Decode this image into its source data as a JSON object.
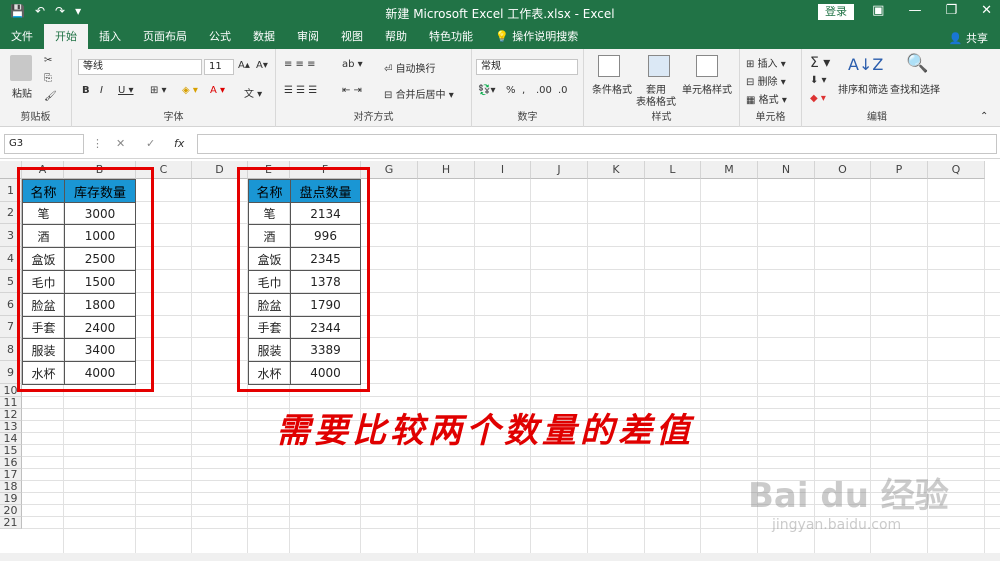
{
  "titlebar": {
    "title": "新建 Microsoft Excel 工作表.xlsx  -  Excel",
    "login": "登录",
    "qat": [
      "💾",
      "↶",
      "↷",
      "▾"
    ],
    "winbtns": [
      "▣",
      "—",
      "❐",
      "✕"
    ]
  },
  "tabs": [
    "文件",
    "开始",
    "插入",
    "页面布局",
    "公式",
    "数据",
    "审阅",
    "视图",
    "帮助",
    "特色功能",
    "💡 操作说明搜索"
  ],
  "share": "共享",
  "ribbon": {
    "clipboard": {
      "paste": "粘贴",
      "label": "剪贴板"
    },
    "font": {
      "name": "等线",
      "size": "11",
      "label": "字体"
    },
    "align": {
      "wrap": "自动换行",
      "merge": "合并后居中",
      "label": "对齐方式"
    },
    "number": {
      "format": "常规",
      "label": "数字"
    },
    "styles": {
      "cond": "条件格式",
      "table1": "套用",
      "table2": "表格格式",
      "cell": "单元格样式",
      "label": "样式"
    },
    "cells": {
      "insert": "插入",
      "delete": "删除",
      "format": "格式",
      "label": "单元格"
    },
    "edit": {
      "sort": "排序和筛选",
      "find": "查找和选择",
      "label": "编辑"
    }
  },
  "formula": {
    "namebox": "G3",
    "fx": "fx"
  },
  "columns": [
    "A",
    "B",
    "C",
    "D",
    "E",
    "F",
    "G",
    "H",
    "I",
    "J",
    "K",
    "L",
    "M",
    "N",
    "O",
    "P",
    "Q"
  ],
  "rows": [
    "1",
    "2",
    "3",
    "4",
    "5",
    "6",
    "7",
    "8",
    "9",
    "10",
    "11",
    "12",
    "13",
    "14",
    "15",
    "16",
    "17",
    "18",
    "19",
    "20",
    "21"
  ],
  "table1": {
    "headers": [
      "名称",
      "库存数量"
    ],
    "rows": [
      [
        "笔",
        "3000"
      ],
      [
        "酒",
        "1000"
      ],
      [
        "盒饭",
        "2500"
      ],
      [
        "毛巾",
        "1500"
      ],
      [
        "脸盆",
        "1800"
      ],
      [
        "手套",
        "2400"
      ],
      [
        "服装",
        "3400"
      ],
      [
        "水杯",
        "4000"
      ]
    ]
  },
  "table2": {
    "headers": [
      "名称",
      "盘点数量"
    ],
    "rows": [
      [
        "笔",
        "2134"
      ],
      [
        "酒",
        "996"
      ],
      [
        "盒饭",
        "2345"
      ],
      [
        "毛巾",
        "1378"
      ],
      [
        "脸盆",
        "1790"
      ],
      [
        "手套",
        "2344"
      ],
      [
        "服装",
        "3389"
      ],
      [
        "水杯",
        "4000"
      ]
    ]
  },
  "annotation": "需要比较两个数量的差值",
  "watermark": {
    "big": "Bai du 经验",
    "small": "jingyan.baidu.com"
  }
}
